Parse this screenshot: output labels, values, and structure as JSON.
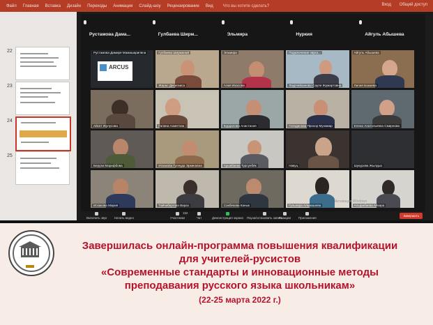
{
  "ribbon": {
    "tabs": [
      "Файл",
      "Главная",
      "Вставка",
      "Дизайн",
      "Переходы",
      "Анимация",
      "Слайд-шоу",
      "Рецензирование",
      "Вид"
    ],
    "search": "Что вы хотите сделать?",
    "right": [
      "Вход",
      "Общий доступ"
    ]
  },
  "slides": {
    "numbers": [
      "22",
      "23",
      "24",
      "25"
    ]
  },
  "zoom": {
    "header_names": [
      "Рустамова Дама...",
      "Гулбаева Ширм...",
      "Эльмира",
      "Нуркия",
      "Айгуль Абышева"
    ],
    "tiles": [
      {
        "top": "Рустамова Дамиря Мамашарипвна",
        "bottom": "",
        "logo": "ARCUS"
      },
      {
        "top": "Гулбаева Ширманай",
        "bottom": "Жарас Дисигаиса"
      },
      {
        "top": "Эльмира",
        "bottom": "Алия Изасова"
      },
      {
        "top": "Подключение звука...",
        "bottom": "Лаурчейхановa Сауле Жумартовна"
      },
      {
        "top": "Айгуль Абышева",
        "bottom": "Лилия Бакаева"
      },
      {
        "top": "Айсет Жулусова",
        "bottom": ""
      },
      {
        "top": "",
        "bottom": "Галина Ахметова"
      },
      {
        "top": "",
        "bottom": "Бурдалова Анастасия"
      },
      {
        "top": "",
        "bottom": "Голодинова Прохор Мухамар"
      },
      {
        "top": "",
        "bottom": "Елена Анатольевна Смирнова"
      },
      {
        "top": "",
        "bottom": "Берузи Марифбова"
      },
      {
        "top": "",
        "bottom": "Искакова Гулнуда Эркиновна"
      },
      {
        "top": "",
        "bottom": "Арывбаева Турсунбёк"
      },
      {
        "top": "",
        "bottom": "Навуц"
      },
      {
        "top": "",
        "bottom": "Шукурова Жылдыз"
      },
      {
        "top": "",
        "bottom": "Искакова Мария"
      },
      {
        "top": "",
        "bottom": "Тайчибергова Вараз"
      },
      {
        "top": "",
        "bottom": "Сакбекова Канык"
      },
      {
        "top": "",
        "bottom": "Гульнара Альмашева"
      },
      {
        "top": "",
        "bottom": "Альфабаева Айзара"
      }
    ],
    "toolbar": {
      "audio": "Включить звук",
      "video": "Начать видео",
      "participants": "Участники",
      "participants_count": "152",
      "chat": "Чат",
      "share": "Демонстрация экрана",
      "record": "Пауза/остановить запись",
      "reactions": "Реакции",
      "apps": "Приложения",
      "end": "Завершить"
    },
    "windows_watermark": "Активация Windows"
  },
  "caption": {
    "line1": "Завершилась онлайн-программа повышения квалификации",
    "line2": "для учителей-русистов",
    "line3": "«Современные стандарты и инновационные методы",
    "line4": "преподавания русского языка школьникам»",
    "line5": "(22-25 марта 2022 г.)"
  },
  "emblem_text": "ИНСТИТУТ РУССКОГО ЯЗЫКА",
  "colors": {
    "ribbon": "#b53d26",
    "caption_text": "#b5122b",
    "caption_bg": "#f7ede6",
    "zoom_bg": "#161616",
    "end_button": "#d23a2c"
  }
}
